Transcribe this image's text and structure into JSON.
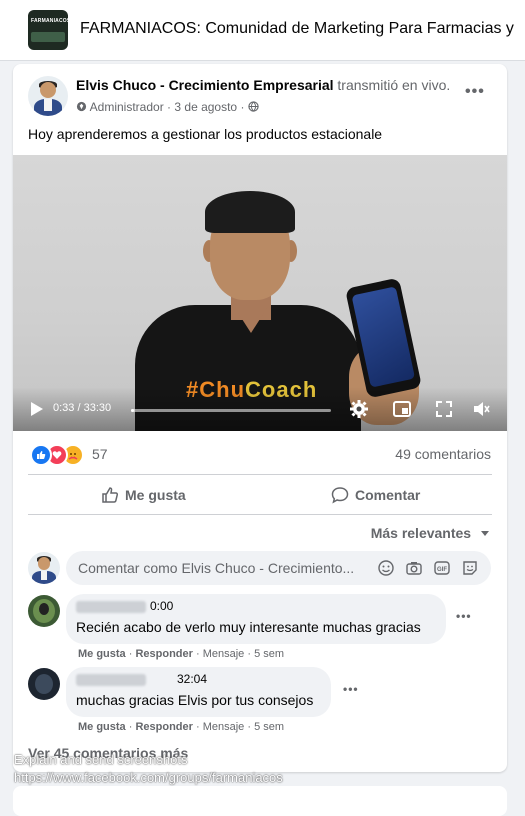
{
  "group": {
    "logo_text": "FARMANIACOS",
    "title": "FARMANIACOS: Comunidad de Marketing Para Farmacias y"
  },
  "post": {
    "author": "Elvis Chuco - Crecimiento Empresarial",
    "action": "transmitió en vivo.",
    "role": "Administrador",
    "date": "3 de agosto",
    "text": "Hoy aprenderemos a gestionar los productos estacionale",
    "shirt_text_hash": "#",
    "shirt_text_chu": "Chu",
    "shirt_text_coach": "Coach",
    "video": {
      "time": "0:33 / 33:30",
      "progress": 0.0164
    },
    "reaction_count": "57",
    "comment_count": "49 comentarios",
    "like_label": "Me gusta",
    "comment_label": "Comentar",
    "sort_label": "Más relevantes",
    "composer_placeholder": "Comentar como Elvis Chuco - Crecimiento..."
  },
  "comments": [
    {
      "time": "0:00",
      "text": "Recién acabo de verlo muy interesante muchas gracias",
      "like": "Me gusta",
      "reply": "Responder",
      "message": "Mensaje",
      "age": "5 sem"
    },
    {
      "time": "32:04",
      "text": "muchas gracias Elvis por tus consejos",
      "like": "Me gusta",
      "reply": "Responder",
      "message": "Mensaje",
      "age": "5 sem"
    }
  ],
  "see_more": "Ver 45 comentarios más",
  "watermark": {
    "line1": "Explain and send screenshots",
    "line2": "https://www.facebook.com/groups/farmaniacos"
  },
  "colors": {
    "like_blue": "#1877f2",
    "love_red": "#f33e58",
    "care_yellow": "#f7b125"
  },
  "icons": [
    "play-icon",
    "settings-icon",
    "picture-in-picture-icon",
    "fullscreen-icon",
    "volume-icon",
    "thumbs-up-icon",
    "comment-icon",
    "emoji-icon",
    "camera-icon",
    "gif-icon",
    "sticker-icon",
    "more-dots-icon",
    "caret-down-icon",
    "globe-icon",
    "admin-shield-icon"
  ]
}
